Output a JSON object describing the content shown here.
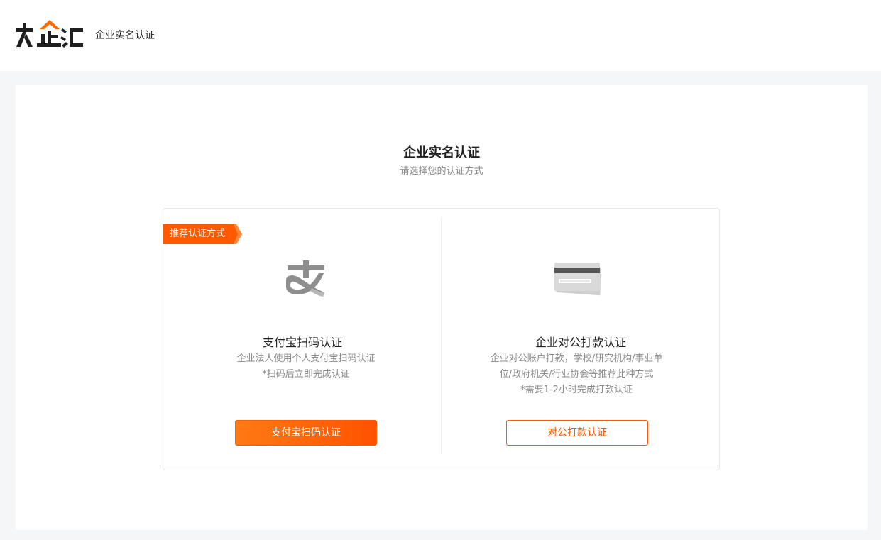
{
  "header": {
    "logo_text": "大企汇",
    "title": "企业实名认证"
  },
  "main": {
    "title": "企业实名认证",
    "subtitle": "请选择您的认证方式"
  },
  "options": {
    "alipay": {
      "badge": "推荐认证方式",
      "icon": "alipay-icon",
      "title": "支付宝扫码认证",
      "desc": [
        "企业法人使用个人支付宝扫码认证",
        "*扫码后立即完成认证"
      ],
      "button": "支付宝扫码认证"
    },
    "bank": {
      "icon": "bank-card-icon",
      "title": "企业对公打款认证",
      "desc": [
        "企业对公账户打款，学校/研究机构/事业单",
        "位/政府机关/行业协会等推荐此种方式",
        "*需要1-2小时完成打款认证"
      ],
      "button": "对公打款认证"
    }
  },
  "colors": {
    "accent": "#ff5a00",
    "logo_dark": "#1f1f1f",
    "logo_orange": "#ff6a00",
    "icon_gray": "#9a9a9a"
  }
}
